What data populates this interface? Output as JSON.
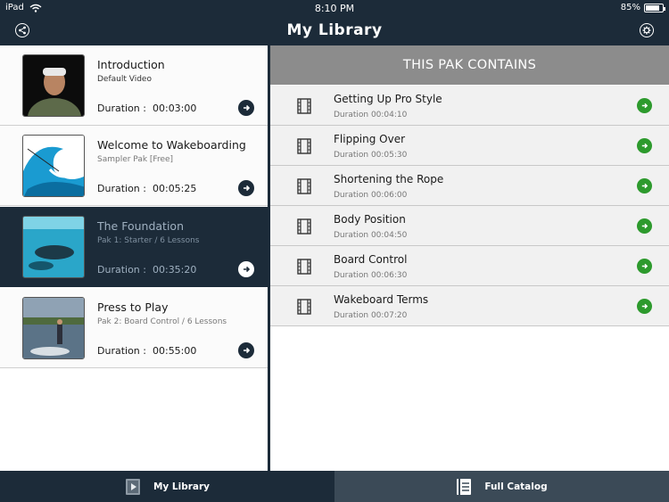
{
  "status_bar": {
    "device": "iPad",
    "time": "8:10 PM",
    "battery": "85%",
    "battery_level": 0.85
  },
  "nav": {
    "title": "My Library",
    "left_icon": "share-icon",
    "right_icon": "gear-icon"
  },
  "paks": [
    {
      "title": "Introduction",
      "subtitle": "Default Video",
      "duration_label": "Duration :",
      "duration": "00:03:00",
      "selected": false,
      "thumb": "person-portrait"
    },
    {
      "title": "Welcome to Wakeboarding",
      "subtitle": "Sampler Pak [Free]",
      "duration_label": "Duration :",
      "duration": "00:05:25",
      "selected": false,
      "thumb": "wave-illustration"
    },
    {
      "title": "The Foundation",
      "subtitle": "Pak 1: Starter / 6 Lessons",
      "duration_label": "Duration :",
      "duration": "00:35:20",
      "selected": true,
      "thumb": "underwater-swimmer"
    },
    {
      "title": "Press to Play",
      "subtitle": "Pak 2: Board Control / 6 Lessons",
      "duration_label": "Duration :",
      "duration": "00:55:00",
      "selected": false,
      "thumb": "wakeboarder-on-lake"
    }
  ],
  "pak_contents": {
    "header": "THIS PAK CONTAINS",
    "lessons": [
      {
        "title": "Getting Up Pro Style",
        "duration": "Duration 00:04:10"
      },
      {
        "title": "Flipping Over",
        "duration": "Duration 00:05:30"
      },
      {
        "title": "Shortening the Rope",
        "duration": "Duration 00:06:00"
      },
      {
        "title": "Body Position",
        "duration": "Duration 00:04:50"
      },
      {
        "title": "Board Control",
        "duration": "Duration 00:06:30"
      },
      {
        "title": "Wakeboard Terms",
        "duration": "Duration 00:07:20"
      }
    ]
  },
  "tabs": [
    {
      "label": "My Library",
      "icon": "library-icon",
      "active": true
    },
    {
      "label": "Full Catalog",
      "icon": "catalog-icon",
      "active": false
    }
  ],
  "colors": {
    "navy": "#1c2b39",
    "header_gray": "#8c8c8c",
    "go_green": "#2d9a2d"
  }
}
